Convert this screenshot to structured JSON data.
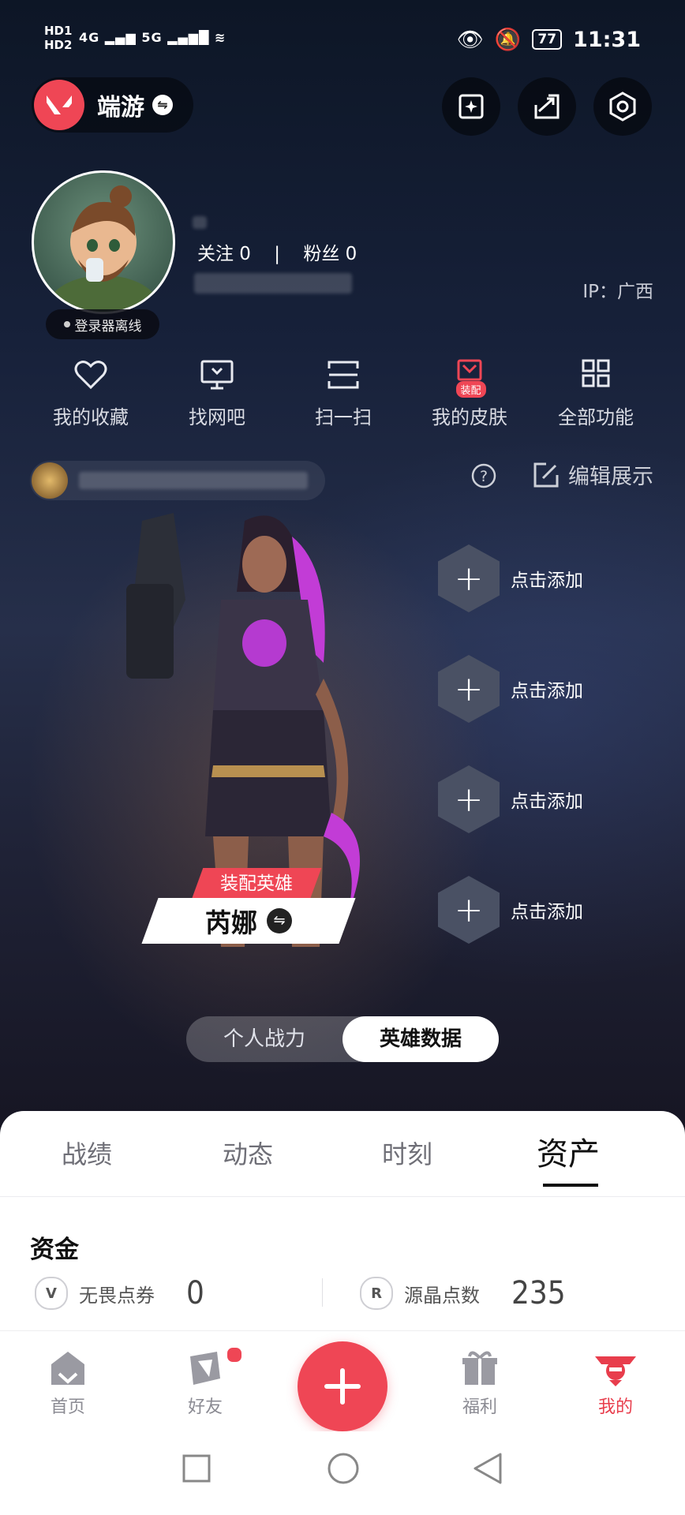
{
  "status_bar": {
    "left_labels": [
      "HD1",
      "HD2"
    ],
    "network_1": "4G",
    "network_2": "5G",
    "battery": "77",
    "time": "11:31"
  },
  "app_bar": {
    "app_name": "端游",
    "buttons": [
      "sparkle-card-icon",
      "share-icon",
      "settings-hex-icon"
    ]
  },
  "profile": {
    "status_badge": "登录器离线",
    "follow": "关注 0",
    "separator": "|",
    "fans": "粉丝 0",
    "ip": "IP：广西"
  },
  "quick_actions": [
    {
      "label": "我的收藏",
      "icon": "heart-icon"
    },
    {
      "label": "找网吧",
      "icon": "monitor-icon"
    },
    {
      "label": "扫一扫",
      "icon": "scan-icon"
    },
    {
      "label": "我的皮肤",
      "icon": "skin-icon",
      "badge": "装配"
    },
    {
      "label": "全部功能",
      "icon": "grid-icon"
    }
  ],
  "showcase": {
    "edit_label": "编辑展示",
    "equipped_tag": "装配英雄",
    "hero_name": "芮娜",
    "slots": [
      "点击添加",
      "点击添加",
      "点击添加",
      "点击添加"
    ]
  },
  "segment": {
    "options": [
      "个人战力",
      "英雄数据"
    ],
    "selected": "英雄数据"
  },
  "tabs": {
    "items": [
      "战绩",
      "动态",
      "时刻",
      "资产"
    ],
    "active": "资产"
  },
  "assets": {
    "title": "资金",
    "items": [
      {
        "label": "无畏点券",
        "value": "0"
      },
      {
        "label": "源晶点数",
        "value": "235"
      }
    ]
  },
  "bottom_nav": {
    "items": [
      "首页",
      "好友",
      "福利",
      "我的"
    ],
    "active": "我的"
  },
  "colors": {
    "accent": "#ef4655",
    "panel": "#ffffff",
    "background_dark": "#17213a"
  }
}
